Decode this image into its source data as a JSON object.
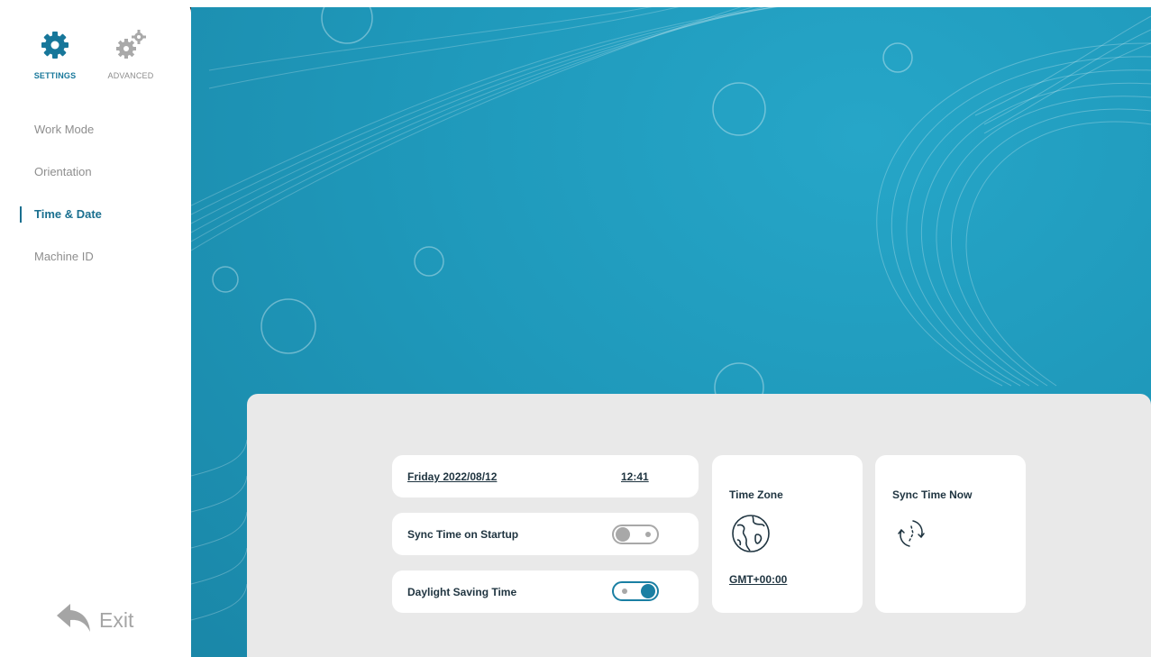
{
  "sidebar": {
    "tabs": [
      {
        "label": "SETTINGS",
        "icon": "gear-icon"
      },
      {
        "label": "ADVANCED",
        "icon": "gears-icon"
      }
    ],
    "items": [
      {
        "label": "Work Mode"
      },
      {
        "label": "Orientation"
      },
      {
        "label": "Time & Date"
      },
      {
        "label": "Machine ID"
      }
    ],
    "active_item": "Time & Date",
    "exit_label": "Exit"
  },
  "time_date": {
    "date": "Friday 2022/08/12",
    "time": "12:41",
    "sync_on_startup": {
      "label": "Sync Time on Startup",
      "enabled": false
    },
    "dst": {
      "label": "Daylight Saving Time",
      "enabled": true
    },
    "time_zone": {
      "title": "Time Zone",
      "value": "GMT+00:00",
      "icon": "globe-icon"
    },
    "sync_now": {
      "title": "Sync Time Now",
      "icon": "sync-icon"
    }
  },
  "colors": {
    "accent": "#1a7fa3",
    "background": "#1f99bb",
    "panel": "#e9e9e9",
    "inactive_text": "#8e8e8e"
  }
}
